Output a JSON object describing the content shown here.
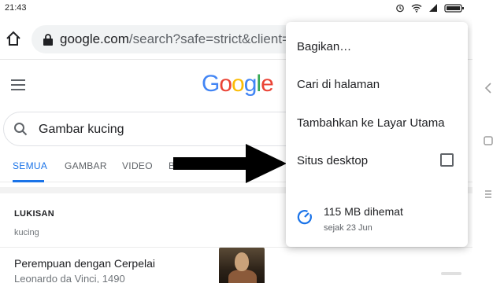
{
  "status_bar": {
    "time": "21:43",
    "icons": [
      "alarm-icon",
      "wifi-icon",
      "signal-icon",
      "battery-icon"
    ]
  },
  "browser": {
    "url_host": "google.com",
    "url_rest": "/search?safe=strict&client=ms-an"
  },
  "google": {
    "logo": [
      "G",
      "o",
      "o",
      "g",
      "l",
      "e"
    ],
    "query": "Gambar kucing",
    "tabs": [
      {
        "label": "SEMUA",
        "active": true
      },
      {
        "label": "GAMBAR",
        "active": false
      },
      {
        "label": "VIDEO",
        "active": false
      },
      {
        "label": "B",
        "active": false
      }
    ],
    "section": {
      "title": "LUKISAN",
      "subtitle": "kucing"
    },
    "result": {
      "title": "Perempuan dengan Cerpelai",
      "subtitle": "Leonardo da Vinci, 1490"
    }
  },
  "menu": {
    "items": [
      "Bagikan…",
      "Cari di halaman",
      "Tambahkan ke Layar Utama",
      "Situs desktop"
    ],
    "desktop_checked": false,
    "saved_title": "115 MB dihemat",
    "saved_subtitle": "sejak 23 Jun"
  },
  "colors": {
    "accent": "#1a73e8",
    "text": "#202124",
    "muted": "#5f6368"
  }
}
